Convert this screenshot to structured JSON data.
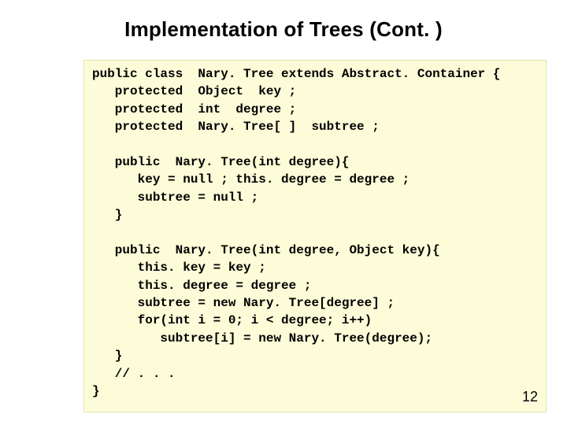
{
  "title": "Implementation of Trees (Cont. )",
  "code": {
    "l01": "public class  Nary. Tree extends Abstract. Container {",
    "l02": "   protected  Object  key ;",
    "l03": "   protected  int  degree ;",
    "l04": "   protected  Nary. Tree[ ]  subtree ;",
    "l05": "",
    "l06": "   public  Nary. Tree(int degree){",
    "l07": "      key = null ; this. degree = degree ;",
    "l08": "      subtree = null ;",
    "l09": "   }",
    "l10": "",
    "l11": "   public  Nary. Tree(int degree, Object key){",
    "l12": "      this. key = key ;",
    "l13": "      this. degree = degree ;",
    "l14": "      subtree = new Nary. Tree[degree] ;",
    "l15": "      for(int i = 0; i < degree; i++)",
    "l16": "         subtree[i] = new Nary. Tree(degree);",
    "l17": "   }",
    "l18": "   // . . .",
    "l19": "}"
  },
  "pagenum": "12"
}
